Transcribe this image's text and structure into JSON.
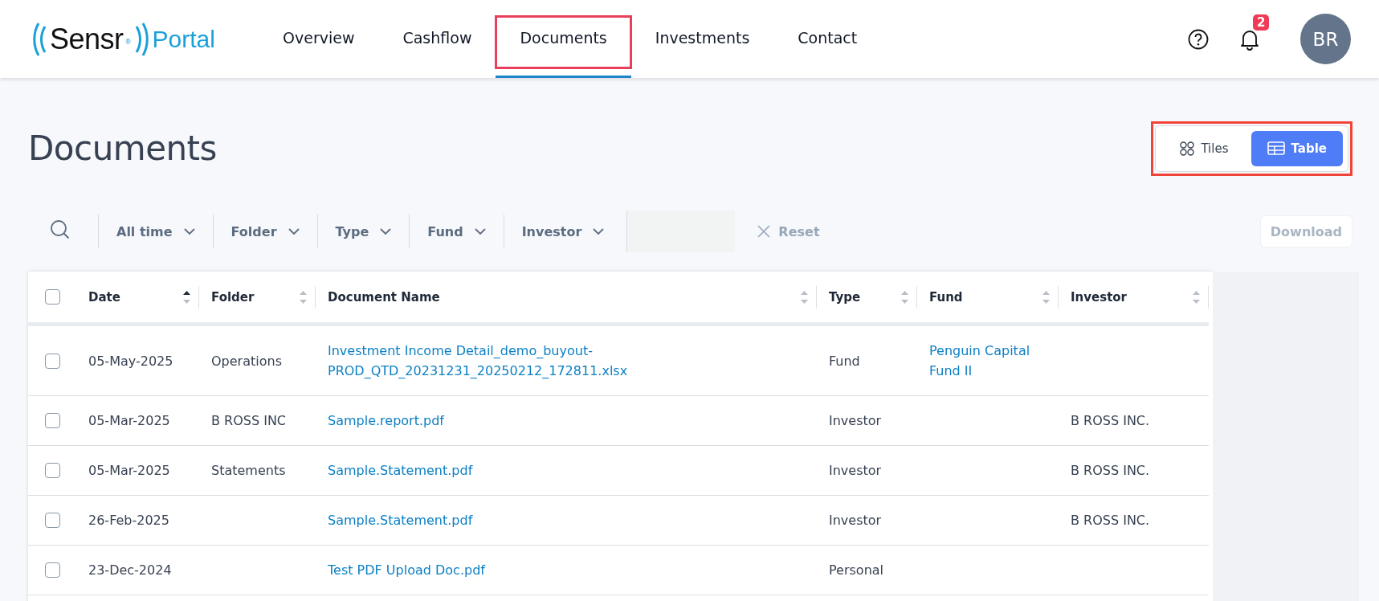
{
  "header": {
    "logo": {
      "name": "Sensr",
      "mark": "®",
      "product": "Portal"
    },
    "nav": [
      {
        "label": "Overview",
        "selected": false,
        "highlighted": false
      },
      {
        "label": "Cashflow",
        "selected": false,
        "highlighted": false
      },
      {
        "label": "Documents",
        "selected": true,
        "highlighted": true
      },
      {
        "label": "Investments",
        "selected": false,
        "highlighted": false
      },
      {
        "label": "Contact",
        "selected": false,
        "highlighted": false
      }
    ],
    "notifications": {
      "count": "2"
    },
    "avatar": {
      "initials": "BR"
    }
  },
  "page_title": "Documents",
  "view_toggle": {
    "highlighted": true,
    "options": [
      {
        "label": "Tiles",
        "kind": "tiles",
        "selected": false
      },
      {
        "label": "Table",
        "kind": "table",
        "selected": true
      }
    ]
  },
  "filters": {
    "dropdowns": [
      "All time",
      "Folder",
      "Type",
      "Fund",
      "Investor"
    ],
    "reset": {
      "label": "Reset",
      "disabled": true
    },
    "download": {
      "label": "Download",
      "disabled": true
    }
  },
  "table": {
    "select_all": {
      "checked": false
    },
    "columns": [
      {
        "label": "Date",
        "sorted": true
      },
      {
        "label": "Folder",
        "sorted": false
      },
      {
        "label": "Document Name",
        "sorted": false
      },
      {
        "label": "Type",
        "sorted": false
      },
      {
        "label": "Fund",
        "sorted": false
      },
      {
        "label": "Investor",
        "sorted": false
      }
    ],
    "rows": [
      {
        "checked": false,
        "date": "05-May-2025",
        "folder": "Operations",
        "document": "Investment Income Detail_demo_buyout-PROD_QTD_20231231_20250212_172811.xlsx",
        "type": "Fund",
        "fund": "Penguin Capital Fund II",
        "investor": ""
      },
      {
        "checked": false,
        "date": "05-Mar-2025",
        "folder": "B ROSS INC",
        "document": "Sample.report.pdf",
        "type": "Investor",
        "fund": "",
        "investor": "B ROSS INC."
      },
      {
        "checked": false,
        "date": "05-Mar-2025",
        "folder": "Statements",
        "document": "Sample.Statement.pdf",
        "type": "Investor",
        "fund": "",
        "investor": "B ROSS INC."
      },
      {
        "checked": false,
        "date": "26-Feb-2025",
        "folder": "",
        "document": "Sample.Statement.pdf",
        "type": "Investor",
        "fund": "",
        "investor": "B ROSS INC."
      },
      {
        "checked": false,
        "date": "23-Dec-2024",
        "folder": "",
        "document": "Test PDF Upload Doc.pdf",
        "type": "Personal",
        "fund": "",
        "investor": ""
      }
    ]
  }
}
